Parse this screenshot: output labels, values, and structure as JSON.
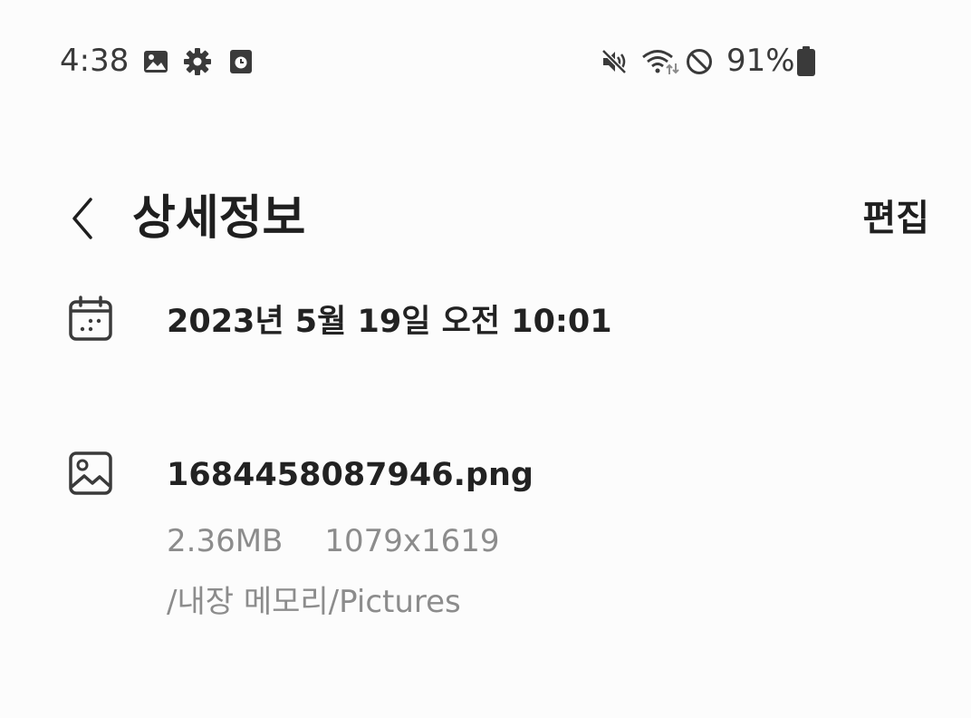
{
  "status_bar": {
    "time": "4:38",
    "battery_percent": "91%",
    "icons": [
      "gallery-notification-icon",
      "settings-notification-icon",
      "screen-recorder-icon",
      "mute-icon",
      "wifi-data-icon",
      "do-not-disturb-icon",
      "battery-icon"
    ]
  },
  "header": {
    "title": "상세정보",
    "edit_label": "편집"
  },
  "details": {
    "date": "2023년 5월 19일 오전 10:01",
    "file_name": "1684458087946.png",
    "file_size": "2.36MB",
    "resolution": "1079x1619",
    "path": "/내장 메모리/Pictures"
  },
  "colors": {
    "background": "#fcfcfc",
    "primary_text": "#1f1f1f",
    "secondary_text": "#8c8c8c"
  }
}
